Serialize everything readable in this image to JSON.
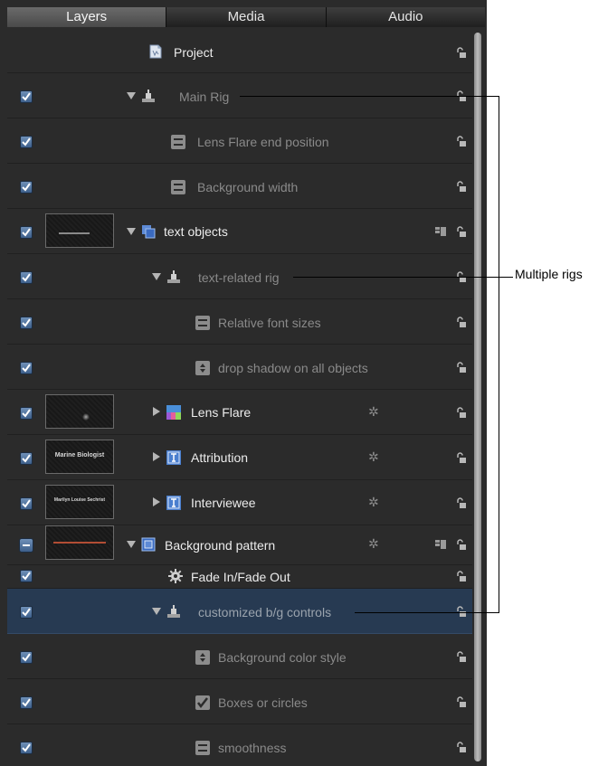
{
  "tabs": [
    {
      "label": "Layers",
      "active": true
    },
    {
      "label": "Media",
      "active": false
    },
    {
      "label": "Audio",
      "active": false
    }
  ],
  "rows": [
    {
      "label": "Project",
      "checkbox": "none",
      "icon": "project-icon",
      "disclosure": "none",
      "dim": false
    },
    {
      "label": "Main Rig",
      "checkbox": "checked",
      "icon": "rig-icon",
      "disclosure": "expanded",
      "dim": true
    },
    {
      "label": "Lens Flare end position",
      "checkbox": "checked",
      "icon": "slider-widget-icon",
      "disclosure": "none",
      "dim": true
    },
    {
      "label": "Background width",
      "checkbox": "checked",
      "icon": "slider-widget-icon",
      "disclosure": "none",
      "dim": true
    },
    {
      "label": "text objects",
      "checkbox": "checked",
      "icon": "group-icon",
      "disclosure": "expanded",
      "dim": false
    },
    {
      "label": "text-related rig",
      "checkbox": "checked",
      "icon": "rig-icon",
      "disclosure": "expanded",
      "dim": true
    },
    {
      "label": "Relative font sizes",
      "checkbox": "checked",
      "icon": "slider-widget-icon",
      "disclosure": "none",
      "dim": true
    },
    {
      "label": "drop shadow on all objects",
      "checkbox": "checked",
      "icon": "popup-widget-icon",
      "disclosure": "none",
      "dim": true
    },
    {
      "label": "Lens Flare",
      "checkbox": "checked",
      "icon": "lens-flare-icon",
      "disclosure": "collapsed",
      "dim": false
    },
    {
      "label": "Attribution",
      "checkbox": "checked",
      "icon": "text-layer-icon",
      "disclosure": "collapsed",
      "dim": false
    },
    {
      "label": "Interviewee",
      "checkbox": "checked",
      "icon": "text-layer-icon",
      "disclosure": "collapsed",
      "dim": false
    },
    {
      "label": "Background pattern",
      "checkbox": "mixed",
      "icon": "group-icon",
      "disclosure": "expanded",
      "dim": false
    },
    {
      "label": "Fade In/Fade Out",
      "checkbox": "checked",
      "icon": "behavior-gear-icon",
      "disclosure": "none",
      "dim": false
    },
    {
      "label": "customized b/g controls",
      "checkbox": "checked",
      "icon": "rig-icon",
      "disclosure": "expanded",
      "dim": true,
      "selected": true
    },
    {
      "label": "Background color style",
      "checkbox": "checked",
      "icon": "popup-widget-icon",
      "disclosure": "none",
      "dim": true
    },
    {
      "label": "Boxes or circles",
      "checkbox": "checked",
      "icon": "checkbox-widget-icon",
      "disclosure": "none",
      "dim": true
    },
    {
      "label": "smoothness",
      "checkbox": "checked",
      "icon": "slider-widget-icon",
      "disclosure": "none",
      "dim": true
    }
  ],
  "thumbnails": {
    "attribution": "Marine Biologist",
    "interviewee": "Marilyn Louise Sechrist"
  },
  "callout": {
    "label": "Multiple rigs"
  },
  "colors": {
    "panel_bg": "#2b2b2b",
    "selection": "#273a52",
    "checkbox": "#4f74a3",
    "text_bright": "#ececec",
    "text_dim": "#8a8a8a"
  }
}
